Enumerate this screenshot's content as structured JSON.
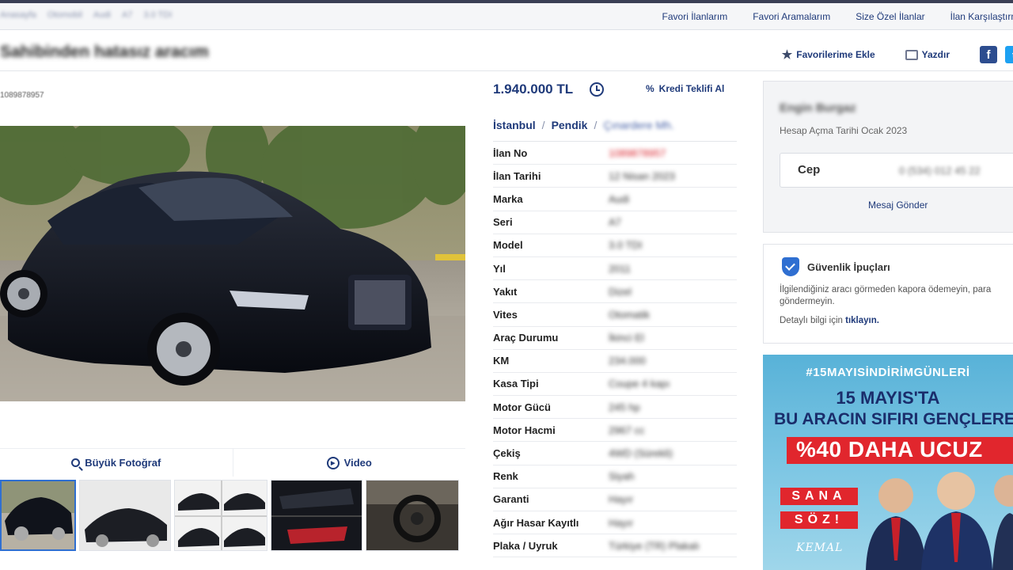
{
  "topnav": {
    "breadcrumbs": [
      "Anasayfa",
      "Otomobil",
      "Audi",
      "A7",
      "3.0 TDI"
    ],
    "links": [
      "Favori İlanlarım",
      "Favori Aramalarım",
      "Size Özel İlanlar",
      "İlan Karşılaştırma"
    ]
  },
  "header": {
    "title": "Sahibinden hatasız aracım",
    "add_favorite": "Favorilerime Ekle",
    "print": "Yazdır",
    "facebook": "f",
    "twitter": "t"
  },
  "listing": {
    "ad_number_top": "1089878957",
    "price": "1.940.000 TL",
    "credit_offer": "Kredi Teklifi Al",
    "location": {
      "city": "İstanbul",
      "district": "Pendik",
      "neighborhood": "Çınardere Mh.",
      "separator": "/"
    }
  },
  "specs": [
    {
      "label": "İlan No",
      "value": "1089878957",
      "highlight": true
    },
    {
      "label": "İlan Tarihi",
      "value": "12 Nisan 2023"
    },
    {
      "label": "Marka",
      "value": "Audi"
    },
    {
      "label": "Seri",
      "value": "A7"
    },
    {
      "label": "Model",
      "value": "3.0 TDI"
    },
    {
      "label": "Yıl",
      "value": "2011"
    },
    {
      "label": "Yakıt",
      "value": "Dizel"
    },
    {
      "label": "Vites",
      "value": "Otomatik"
    },
    {
      "label": "Araç Durumu",
      "value": "İkinci El"
    },
    {
      "label": "KM",
      "value": "234.000"
    },
    {
      "label": "Kasa Tipi",
      "value": "Coupe 4 kapı"
    },
    {
      "label": "Motor Gücü",
      "value": "245 hp"
    },
    {
      "label": "Motor Hacmi",
      "value": "2967 cc"
    },
    {
      "label": "Çekiş",
      "value": "4WD (Sürekli)"
    },
    {
      "label": "Renk",
      "value": "Siyah"
    },
    {
      "label": "Garanti",
      "value": "Hayır"
    },
    {
      "label": "Ağır Hasar Kayıtlı",
      "value": "Hayır"
    },
    {
      "label": "Plaka / Uyruk",
      "value": "Türkiye (TR) Plakalı"
    }
  ],
  "gallery": {
    "big_photo": "Büyük Fotoğraf",
    "video": "Video"
  },
  "seller": {
    "name": "Engin Burgaz",
    "account_date_label": "Hesap Açma Tarihi",
    "account_date": "Ocak 2023",
    "phone_label": "Cep",
    "phone": "0 (534) 012 45 22",
    "message": "Mesaj Gönder"
  },
  "safety": {
    "title": "Güvenlik İpuçları",
    "text": "İlgilendiğiniz aracı görmeden kapora ödemeyin, para göndermeyin.",
    "more_prefix": "Detaylı bilgi için",
    "more_link": "tıklayın."
  },
  "banner": {
    "hashtag": "#15MAYISİNDİRİMGÜNLERİ",
    "line1": "15 MAYIS'TA",
    "line2": "BU ARACIN SIFIRI GENÇLERE",
    "line3": "%40 DAHA UCUZ",
    "sana": "SANA",
    "soz": "SÖZ!",
    "signature": "KEMAL"
  },
  "colors": {
    "link_blue": "#1f3a7a",
    "alert_red": "#d9202a",
    "banner_blue": "#58b2d8"
  }
}
